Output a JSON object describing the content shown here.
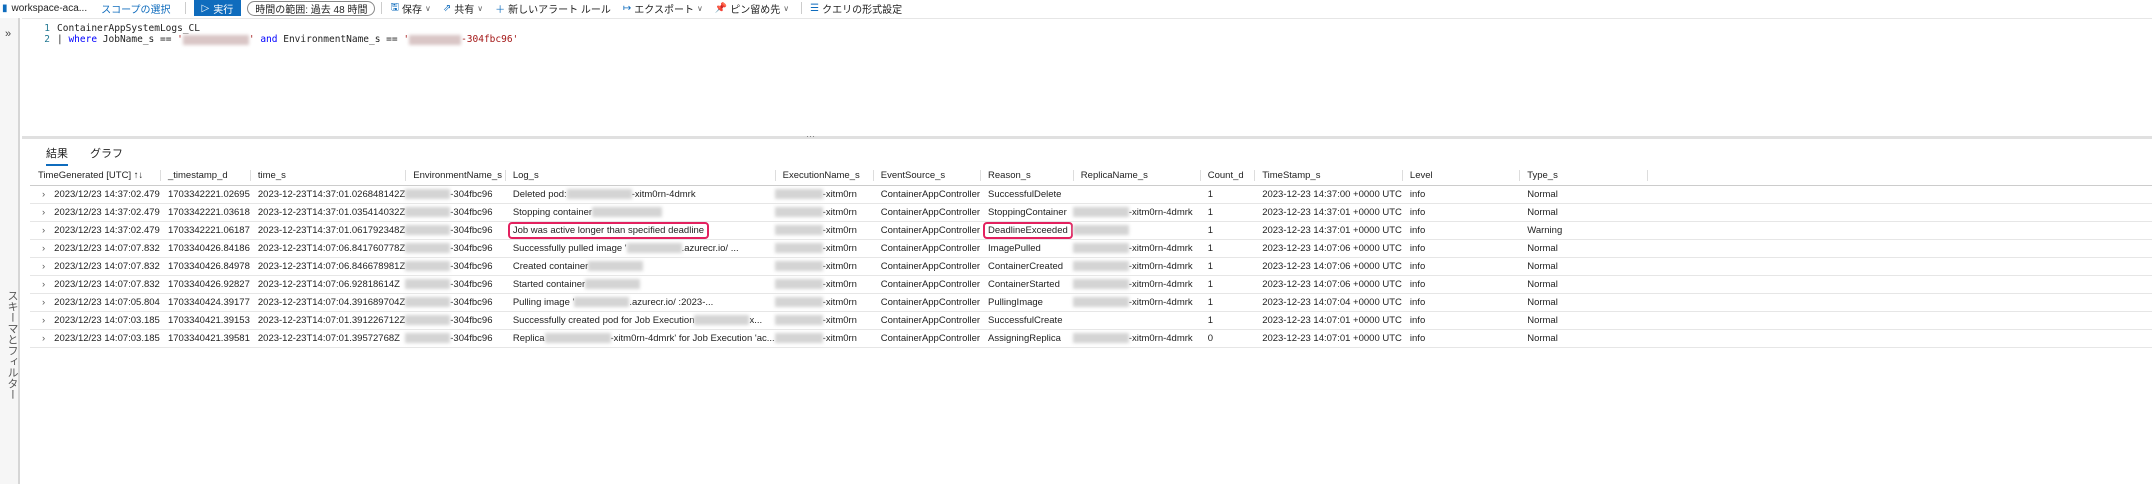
{
  "toolbar": {
    "workspace": "workspace-aca...",
    "scope": "スコープの選択",
    "run": "実行",
    "time_range": "時間の範囲: 過去 48 時間",
    "save": "保存",
    "share": "共有",
    "new_alert": "新しいアラート ルール",
    "export": "エクスポート",
    "pin": "ピン留め先",
    "format": "クエリの形式設定"
  },
  "sidebar": {
    "expand": "»",
    "label": "スキーマとフィルター"
  },
  "editor": {
    "line1": "ContainerAppSystemLogs_CL",
    "line2_pipe": "| ",
    "line2_where": "where",
    "line2_a": " JobName_s == ",
    "line2_q1": "'",
    "line2_q2": "'",
    "line2_and": " and ",
    "line2_b": "EnvironmentName_s == ",
    "line2_q3": "'",
    "line2_env": "-304fbc96'"
  },
  "results": {
    "tabs": [
      "結果",
      "グラフ"
    ],
    "columns": [
      "TimeGenerated [UTC] ↑↓",
      "_timestamp_d",
      "time_s",
      "EnvironmentName_s",
      "Log_s",
      "ExecutionName_s",
      "EventSource_s",
      "Reason_s",
      "ReplicaName_s",
      "Count_d",
      "TimeStamp_s",
      "Level",
      "Type_s"
    ],
    "rows": [
      {
        "tg": "2023/12/23 14:37:02.479",
        "ts": "1703342221.02695",
        "time": "2023-12-23T14:37:01.026848142Z",
        "env": "-304fbc96",
        "log_pre": "Deleted pod:",
        "log_post": "-xitm0rn-4dmrk",
        "exec": "-xitm0rn",
        "src": "ContainerAppController",
        "reason": "SuccessfulDelete",
        "replica": "",
        "count": "1",
        "stamp": "2023-12-23 14:37:00 +0000 UTC",
        "level": "info",
        "type": "Normal"
      },
      {
        "tg": "2023/12/23 14:37:02.479",
        "ts": "1703342221.03618",
        "time": "2023-12-23T14:37:01.035414032Z",
        "env": "-304fbc96",
        "log_pre": "Stopping container",
        "log_post": "",
        "exec": "-xitm0rn",
        "src": "ContainerAppController",
        "reason": "StoppingContainer",
        "replica": "-xitm0rn-4dmrk",
        "count": "1",
        "stamp": "2023-12-23 14:37:01 +0000 UTC",
        "level": "info",
        "type": "Normal"
      },
      {
        "tg": "2023/12/23 14:37:02.479",
        "ts": "1703342221.06187",
        "time": "2023-12-23T14:37:01.061792348Z",
        "env": "-304fbc96",
        "log_pre": "Job was active longer than specified deadline",
        "log_post": "",
        "exec": "-xitm0rn",
        "src": "ContainerAppController",
        "reason": "DeadlineExceeded",
        "replica": "",
        "count": "1",
        "stamp": "2023-12-23 14:37:01 +0000 UTC",
        "level": "info",
        "type": "Warning",
        "highlight": true
      },
      {
        "tg": "2023/12/23 14:07:07.832",
        "ts": "1703340426.84186",
        "time": "2023-12-23T14:07:06.841760778Z",
        "env": "-304fbc96",
        "log_pre": "Successfully pulled image '",
        "log_post": ".azurecr.io/ ...",
        "exec": "-xitm0rn",
        "src": "ContainerAppController",
        "reason": "ImagePulled",
        "replica": "-xitm0rn-4dmrk",
        "count": "1",
        "stamp": "2023-12-23 14:07:06 +0000 UTC",
        "level": "info",
        "type": "Normal"
      },
      {
        "tg": "2023/12/23 14:07:07.832",
        "ts": "1703340426.84978",
        "time": "2023-12-23T14:07:06.846678981Z",
        "env": "-304fbc96",
        "log_pre": "Created container",
        "log_post": "",
        "exec": "-xitm0rn",
        "src": "ContainerAppController",
        "reason": "ContainerCreated",
        "replica": "-xitm0rn-4dmrk",
        "count": "1",
        "stamp": "2023-12-23 14:07:06 +0000 UTC",
        "level": "info",
        "type": "Normal"
      },
      {
        "tg": "2023/12/23 14:07:07.832",
        "ts": "1703340426.92827",
        "time": "2023-12-23T14:07:06.92818614Z",
        "env": "-304fbc96",
        "log_pre": "Started container",
        "log_post": "",
        "exec": "-xitm0rn",
        "src": "ContainerAppController",
        "reason": "ContainerStarted",
        "replica": "-xitm0rn-4dmrk",
        "count": "1",
        "stamp": "2023-12-23 14:07:06 +0000 UTC",
        "level": "info",
        "type": "Normal"
      },
      {
        "tg": "2023/12/23 14:07:05.804",
        "ts": "1703340424.39177",
        "time": "2023-12-23T14:07:04.391689704Z",
        "env": "-304fbc96",
        "log_pre": "Pulling image '",
        "log_post": ".azurecr.io/ :2023-...",
        "exec": "-xitm0rn",
        "src": "ContainerAppController",
        "reason": "PullingImage",
        "replica": "-xitm0rn-4dmrk",
        "count": "1",
        "stamp": "2023-12-23 14:07:04 +0000 UTC",
        "level": "info",
        "type": "Normal"
      },
      {
        "tg": "2023/12/23 14:07:03.185",
        "ts": "1703340421.39153",
        "time": "2023-12-23T14:07:01.391226712Z",
        "env": "-304fbc96",
        "log_pre": "Successfully created pod for Job Execution",
        "log_post": "x...",
        "exec": "-xitm0rn",
        "src": "ContainerAppController",
        "reason": "SuccessfulCreate",
        "replica": "",
        "count": "1",
        "stamp": "2023-12-23 14:07:01 +0000 UTC",
        "level": "info",
        "type": "Normal"
      },
      {
        "tg": "2023/12/23 14:07:03.185",
        "ts": "1703340421.39581",
        "time": "2023-12-23T14:07:01.39572768Z",
        "env": "-304fbc96",
        "log_pre": "Replica",
        "log_post": "-xitm0rn-4dmrk' for Job Execution 'ac...",
        "exec": "-xitm0rn",
        "src": "ContainerAppController",
        "reason": "AssigningReplica",
        "replica": "-xitm0rn-4dmrk",
        "count": "0",
        "stamp": "2023-12-23 14:07:01 +0000 UTC",
        "level": "info",
        "type": "Normal"
      }
    ]
  },
  "colors": {
    "accent": "#0f6cbd",
    "highlight": "#e3215f"
  }
}
